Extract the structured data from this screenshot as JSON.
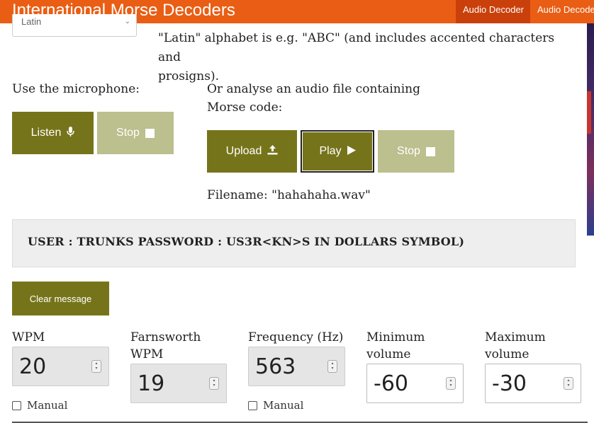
{
  "header": {
    "title": "International Morse Decoders",
    "nav": [
      "Audio Decoder",
      "Audio Decoder"
    ]
  },
  "alphabet_select": {
    "value": "Latin"
  },
  "intro": {
    "lines": [
      "\"Latin\" alphabet is e.g. \"ABC\" (and includes accented characters and",
      "prosigns)."
    ]
  },
  "microphone": {
    "label": "Use the microphone:",
    "listen_label": "Listen",
    "stop_label": "Stop"
  },
  "file": {
    "label": "Or analyse an audio file containing Morse code:",
    "upload_label": "Upload",
    "play_label": "Play",
    "stop_label": "Stop",
    "filename_text": "Filename: \"hahahaha.wav\""
  },
  "message": {
    "text": "USER : TRUNKS PASSWORD : US3R<KN>S IN DOLLARS SYMBOL)",
    "clear_label": "Clear message"
  },
  "settings": {
    "wpm": {
      "label": "WPM",
      "value": "20",
      "manual_label": "Manual"
    },
    "farnsworth": {
      "label": "Farnsworth WPM",
      "value": "19"
    },
    "frequency": {
      "label": "Frequency (Hz)",
      "value": "563",
      "manual_label": "Manual"
    },
    "min_volume": {
      "label": "Minimum volume",
      "value": "-60"
    },
    "max_volume": {
      "label": "Maximum volume",
      "value": "-30"
    }
  },
  "icons": {
    "microphone": "microphone-icon",
    "stop": "stop-square-icon",
    "upload": "upload-icon",
    "play": "play-triangle-icon",
    "spinner": "spinner-arrows-icon"
  },
  "colors": {
    "header_bg": "#e95e14",
    "nav_active_bg": "#c9400a",
    "button_dark": "#76741a",
    "button_disabled": "#bcbf8e",
    "message_bg": "#eeeeee"
  }
}
